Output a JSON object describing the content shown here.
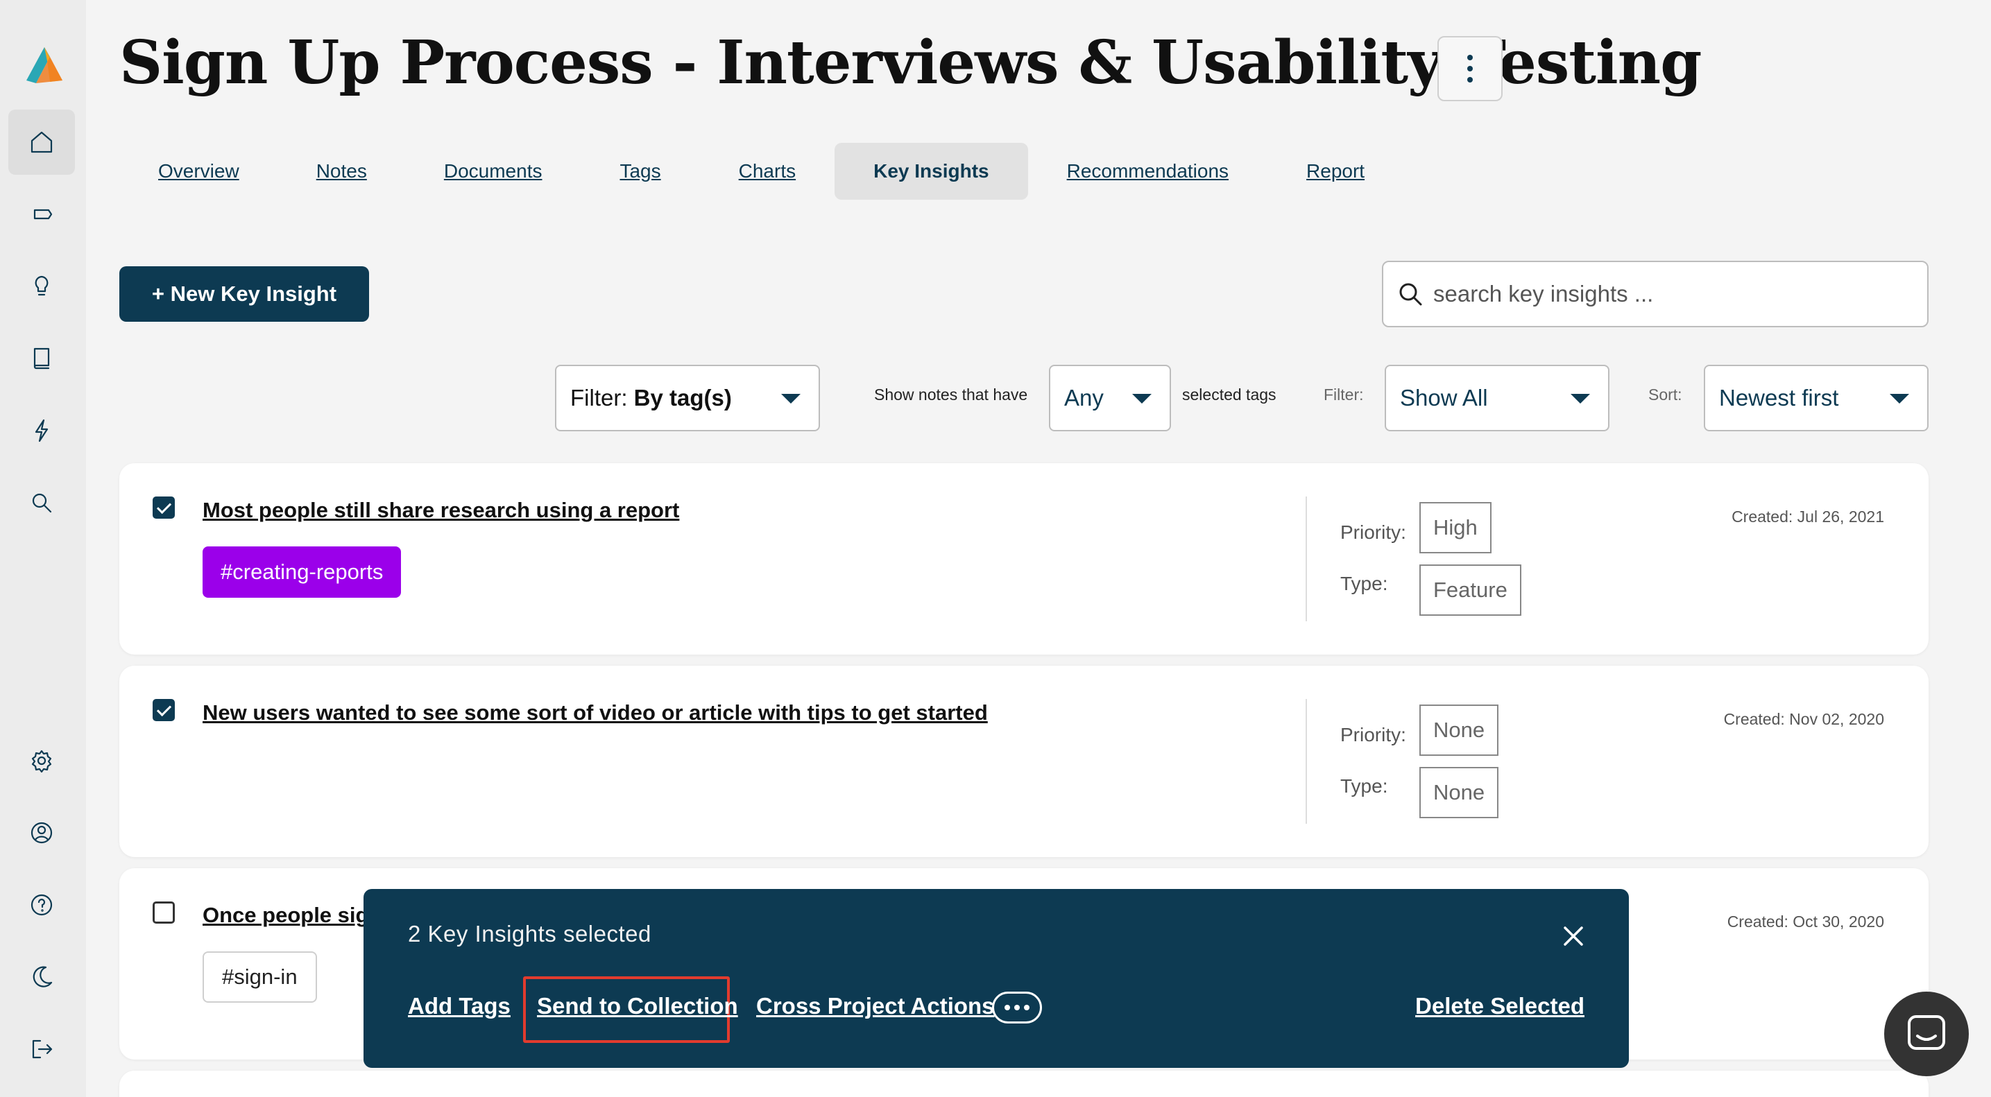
{
  "page": {
    "title": "Sign Up Process - Interviews & Usability Testing"
  },
  "colors": {
    "primary": "#0d3a52",
    "tag_purple": "#9b00ea",
    "highlight": "#e23b2e"
  },
  "sidebar": {
    "items": [
      {
        "icon": "home-icon"
      },
      {
        "icon": "tag-icon"
      },
      {
        "icon": "lightbulb-icon"
      },
      {
        "icon": "book-icon"
      },
      {
        "icon": "lightning-icon"
      },
      {
        "icon": "search-icon"
      },
      {
        "icon": "gear-icon"
      },
      {
        "icon": "user-icon"
      },
      {
        "icon": "help-icon"
      },
      {
        "icon": "moon-icon"
      },
      {
        "icon": "logout-icon"
      }
    ]
  },
  "tabs": [
    {
      "label": "Overview"
    },
    {
      "label": "Notes"
    },
    {
      "label": "Documents"
    },
    {
      "label": "Tags"
    },
    {
      "label": "Charts"
    },
    {
      "label": "Key Insights",
      "active": true
    },
    {
      "label": "Recommendations"
    },
    {
      "label": "Report"
    }
  ],
  "toolbar": {
    "new_label": "+ New Key Insight",
    "search_placeholder": "search key insights ..."
  },
  "filters": {
    "tag_filter_prefix": "Filter: ",
    "tag_filter_value": "By tag(s)",
    "show_notes_label": "Show notes that have",
    "match_value": "Any",
    "selected_tags_label": "selected tags",
    "filter_label": "Filter:",
    "filter_value": "Show All",
    "sort_label": "Sort:",
    "sort_value": "Newest first"
  },
  "insights": [
    {
      "title": "Most people still share research using a report",
      "tag": "#creating-reports",
      "priority_label": "Priority:",
      "priority": "High",
      "type_label": "Type:",
      "type": "Feature",
      "created": "Created: Jul 26, 2021",
      "checked": true
    },
    {
      "title": "New users wanted to see some sort of video or article with tips to get started",
      "tag": "",
      "priority_label": "Priority:",
      "priority": "None",
      "type_label": "Type:",
      "type": "None",
      "created": "Created: Nov 02, 2020",
      "checked": true
    },
    {
      "title": "Once people sig",
      "tag": "#sign-in",
      "created": "Created: Oct 30, 2020",
      "checked": false
    }
  ],
  "action_bar": {
    "count_text": "2 Key Insights selected",
    "add_tags": "Add Tags",
    "send_to_collection": "Send to Collection",
    "cross_project": "Cross Project Actions",
    "delete_selected": "Delete Selected"
  }
}
